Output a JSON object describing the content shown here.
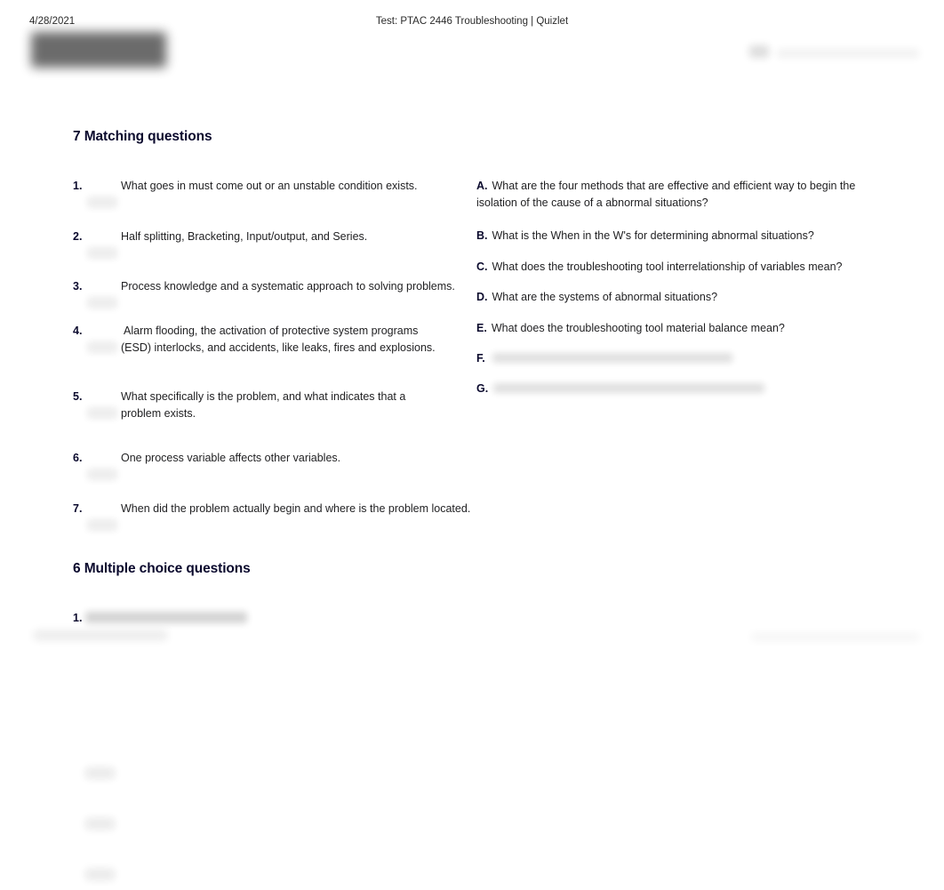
{
  "page": {
    "print_date": "4/28/2021",
    "document_title": "Test: PTAC 2446 Troubleshooting | Quizlet",
    "brand_logo": "quizlet-logo (blurred)",
    "background_color": "#ffffff",
    "text_color": "#1f1f21",
    "heading_color": "#0a092d"
  },
  "sections": {
    "matching": {
      "heading": "7 Matching questions",
      "count": 7,
      "items": [
        {
          "number": "1.",
          "text": "What goes in must come out or an unstable condition exists.",
          "answer_slot": ""
        },
        {
          "number": "2.",
          "text": "Half splitting, Bracketing, Input/output, and Series.",
          "answer_slot": ""
        },
        {
          "number": "3.",
          "text": "Process knowledge and a systematic approach to solving problems.",
          "answer_slot": ""
        },
        {
          "number": "4.",
          "text": "Alarm flooding, the activation of protective system programs (ESD) interlocks, and accidents, like leaks, fires and explosions.",
          "answer_slot": ""
        },
        {
          "number": "5.",
          "text": "What specifically is the problem, and what indicates that a problem exists.",
          "answer_slot": ""
        },
        {
          "number": "6.",
          "text": "One process variable affects other variables.",
          "answer_slot": ""
        },
        {
          "number": "7.",
          "text": "When did the problem actually begin and where is the problem located.",
          "answer_slot": ""
        }
      ],
      "options": [
        {
          "letter": "A.",
          "text": "What are the four methods that are effective and efficient way to begin the isolation of the cause of a abnormal situations?",
          "redacted": false
        },
        {
          "letter": "B.",
          "text": "What is the When in the W's for determining abnormal situations?",
          "redacted": false
        },
        {
          "letter": "C.",
          "text": "What does the troubleshooting tool interrelationship of variables mean?",
          "redacted": false
        },
        {
          "letter": "D.",
          "text": "What are the systems of abnormal situations?",
          "redacted": false
        },
        {
          "letter": "E.",
          "text": "What does the troubleshooting tool material balance mean?",
          "redacted": false
        },
        {
          "letter": "F.",
          "text": "",
          "redacted": true
        },
        {
          "letter": "G.",
          "text": "",
          "redacted": true
        }
      ]
    },
    "multiple_choice": {
      "heading": "6 Multiple choice questions",
      "count": 6,
      "items": [
        {
          "number": "1.",
          "text": "",
          "redacted": true
        }
      ]
    }
  }
}
